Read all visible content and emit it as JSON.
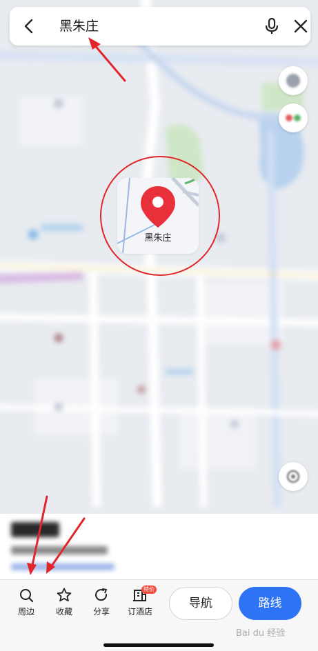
{
  "search": {
    "query": "黑朱庄"
  },
  "marker": {
    "label": "黑朱庄"
  },
  "actions": [
    {
      "label": "周边",
      "icon": "search-icon"
    },
    {
      "label": "收藏",
      "icon": "star-icon"
    },
    {
      "label": "分享",
      "icon": "share-icon"
    },
    {
      "label": "订酒店",
      "icon": "hotel-icon",
      "badge": "特价"
    }
  ],
  "buttons": {
    "navigate": "导航",
    "route": "路线"
  },
  "watermark": "Bai du 经验",
  "colors": {
    "accent": "#2f73f5",
    "marker": "#e8303a",
    "annotation": "#e0262b"
  }
}
